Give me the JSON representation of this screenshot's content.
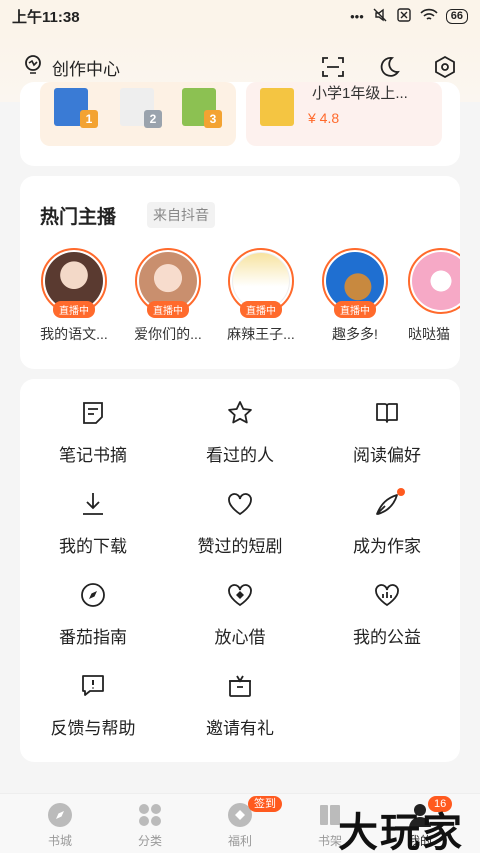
{
  "status_bar": {
    "time": "上午11:38",
    "battery": "66"
  },
  "header": {
    "creator_center": "创作中心"
  },
  "books": [
    {
      "title": "",
      "rating": ""
    },
    {
      "title": "小学1年级上...",
      "rating": "¥ 4.8"
    }
  ],
  "book_numbers": [
    "1",
    "2",
    "3"
  ],
  "anchors": {
    "title": "热门主播",
    "source": "来自抖音",
    "live_label": "直播中",
    "items": [
      {
        "name": "我的语文..."
      },
      {
        "name": "爱你们的..."
      },
      {
        "name": "麻辣王子..."
      },
      {
        "name": "趣多多!"
      },
      {
        "name": "哒哒猫"
      }
    ]
  },
  "menu": {
    "items": [
      {
        "label": "笔记书摘",
        "icon": "note-icon"
      },
      {
        "label": "看过的人",
        "icon": "star-icon"
      },
      {
        "label": "阅读偏好",
        "icon": "book-icon"
      },
      {
        "label": "我的下载",
        "icon": "download-icon"
      },
      {
        "label": "赞过的短剧",
        "icon": "heart-icon"
      },
      {
        "label": "成为作家",
        "icon": "pen-icon"
      },
      {
        "label": "番茄指南",
        "icon": "compass-icon"
      },
      {
        "label": "放心借",
        "icon": "heart-diamond-icon"
      },
      {
        "label": "我的公益",
        "icon": "charity-heart-icon"
      },
      {
        "label": "反馈与帮助",
        "icon": "feedback-icon"
      },
      {
        "label": "邀请有礼",
        "icon": "gift-icon"
      }
    ]
  },
  "tabbar": {
    "items": [
      {
        "label": "书城"
      },
      {
        "label": "分类"
      },
      {
        "label": "福利"
      },
      {
        "label": "书架"
      },
      {
        "label": "我的"
      }
    ],
    "sign_badge": "签到",
    "count_badge": "16"
  },
  "watermark": "大玩家",
  "colors": {
    "accent": "#ff6a2c",
    "background": "#f5f5f5"
  }
}
